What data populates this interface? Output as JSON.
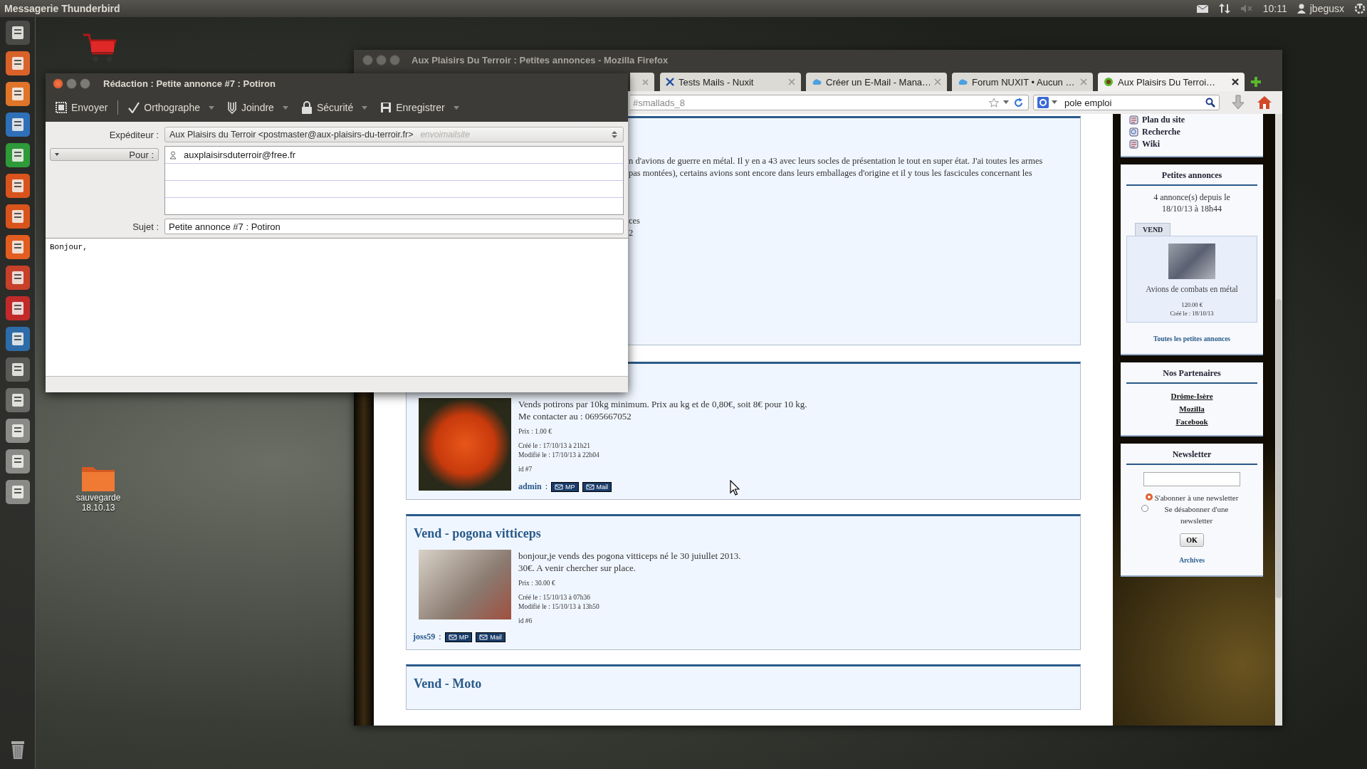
{
  "top_panel": {
    "app_title": "Messagerie Thunderbird",
    "clock": "10:11",
    "user": "jbegusx"
  },
  "desktop_icons": [
    {
      "label": "sauvegarde 18.10.13"
    }
  ],
  "firefox": {
    "title": "Aux Plaisirs Du Terroir : Petites annonces - Mozilla Firefox",
    "tabs": [
      {
        "label": "Tests Mails - Nuxit",
        "selected": false
      },
      {
        "label": "Créer un E-Mail - Mana…",
        "selected": false
      },
      {
        "label": "Forum NUXIT • Aucun …",
        "selected": false
      },
      {
        "label": "Aux Plaisirs Du Terroi…",
        "selected": true
      }
    ],
    "address": "#smallads_8",
    "search": "pole emploi",
    "listings": [
      {
        "kind": "cut",
        "lines": [
          "n d'avions de guerre en métal. Il y en a 43 avec leurs socles de présentation le tout en super état. J'ai toutes les armes",
          "pas montées), certains avions sont encore dans leurs emballages d'origine et il y tous les fascicules concernant les"
        ],
        "extra": [
          "ces",
          "2"
        ]
      },
      {
        "kind": "author_in_text",
        "description": [
          "Vends potirons par 10kg minimum. Prix au kg et de 0,80€, soit 8€ pour 10 kg.",
          "Me contacter au : 0695667052"
        ],
        "price": "Prix : 1.00 €",
        "created": "Créé le : 17/10/13 à 21h21",
        "modified": "Modifié le : 17/10/13 à 22h04",
        "id": "id #7",
        "author": "admin",
        "sep": ":",
        "buttons": [
          "MP",
          "Mail"
        ]
      },
      {
        "kind": "author_below",
        "title": "Vend - pogona vitticeps",
        "description": [
          "bonjour,je vends des pogona vitticeps né le 30 juiullet 2013.",
          "30€. A venir chercher sur place."
        ],
        "price": "Prix : 30.00 €",
        "created": "Créé le : 15/10/13 à 07h36",
        "modified": "Modifié le : 15/10/13 à 13h50",
        "id": "id #6",
        "author": "joss59",
        "sep": ":",
        "buttons": [
          "MP",
          "Mail"
        ]
      },
      {
        "kind": "title_only",
        "title": "Vend - Moto"
      }
    ],
    "sidebar": {
      "menu_links": [
        "Plan du site",
        "Recherche",
        "Wiki"
      ],
      "ads_box": {
        "title": "Petites annonces",
        "summary": "4 annonce(s) depuis le 18/10/13 à 18h44",
        "tag": "VEND",
        "item_title": "Avions de combats en métal",
        "price": "120.00 €",
        "created": "Créé le : 18/10/13",
        "all_link": "Toutes les petites annonces"
      },
      "partners": {
        "title": "Nos Partenaires",
        "links": [
          "Drôme-Isère",
          "Mozilla",
          "Facebook"
        ]
      },
      "newsletter": {
        "title": "Newsletter",
        "options": [
          {
            "label": "S'abonner à une newsletter",
            "selected": true
          },
          {
            "label": "Se désabonner d'une newsletter",
            "selected": false
          }
        ],
        "button": "OK",
        "archives": "Archives"
      }
    }
  },
  "compose": {
    "title": "Rédaction : Petite annonce #7 : Potiron",
    "toolbar": [
      {
        "label": "Envoyer",
        "kind": "send",
        "menu": false
      },
      {
        "label": "Orthographe",
        "kind": "spell",
        "menu": true
      },
      {
        "label": "Joindre",
        "kind": "attach",
        "menu": true
      },
      {
        "label": "Sécurité",
        "kind": "security",
        "menu": true
      },
      {
        "label": "Enregistrer",
        "kind": "save",
        "menu": true
      }
    ],
    "from_label": "Expéditeur :",
    "from": "Aux Plaisirs du Terroir <postmaster@aux-plaisirs-du-terroir.fr>",
    "from_identity": "envoimailsite",
    "to_label": "Pour :",
    "recipients": [
      "auxplaisirsduterroir@free.fr"
    ],
    "subject_label": "Sujet :",
    "subject": "Petite annonce #7 : Potiron",
    "body": "Bonjour,"
  }
}
